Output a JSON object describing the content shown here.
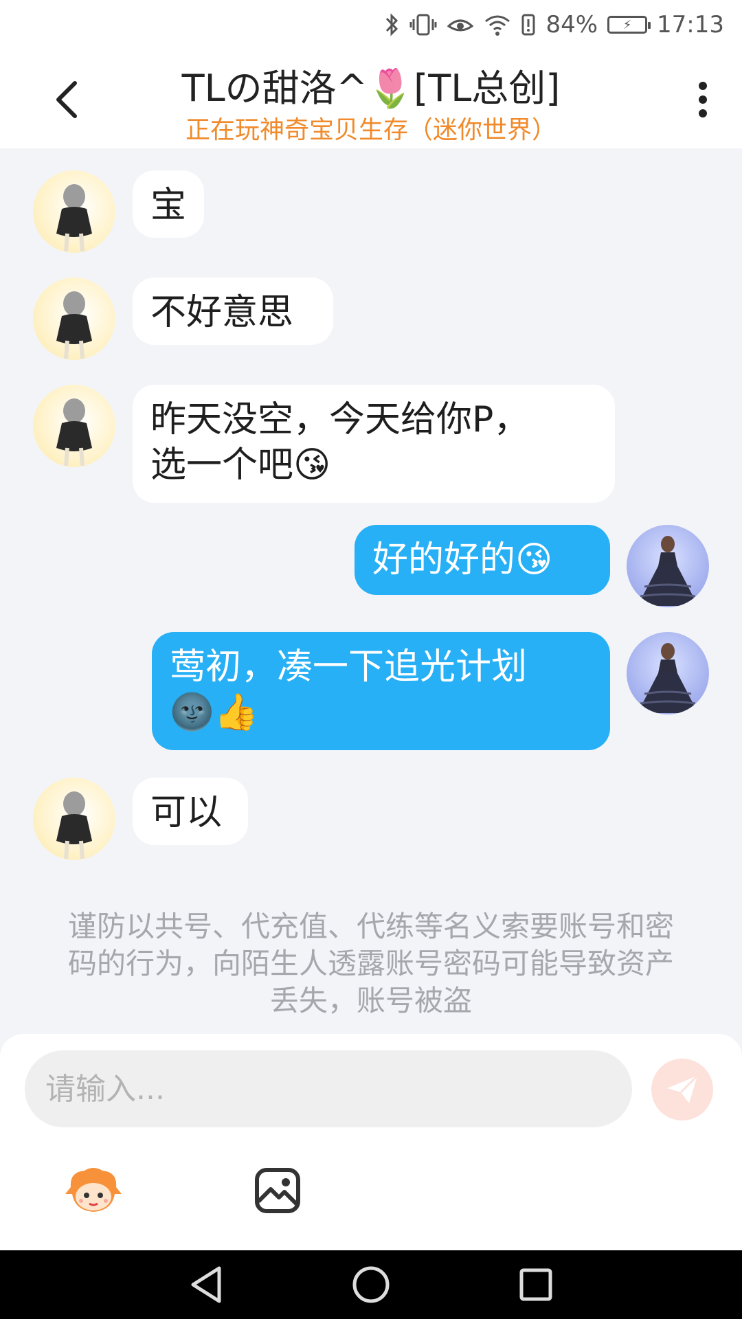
{
  "status_bar": {
    "icons": [
      "bluetooth-icon",
      "vibrate-icon",
      "eye-comfort-icon",
      "wifi-icon",
      "battery-alert-icon"
    ],
    "battery_percent": "84%",
    "time": "17:13"
  },
  "header": {
    "title": "TLの甜洛^🌷[TL总创]",
    "subtitle": "正在玩神奇宝贝生存（迷你世界）",
    "back_icon": "chevron-left-icon",
    "more_icon": "more-vertical-icon"
  },
  "messages": [
    {
      "sender": "other",
      "text": "宝"
    },
    {
      "sender": "other",
      "text": "不好意思"
    },
    {
      "sender": "other",
      "text": "昨天没空，今天给你P，\n选一个吧😘"
    },
    {
      "sender": "me",
      "text": "好的好的😘"
    },
    {
      "sender": "me",
      "text": "莺初，凑一下追光计划\n🌚👍"
    },
    {
      "sender": "other",
      "text": "可以"
    }
  ],
  "warning_text": "谨防以共号、代充值、代练等名义索要账号和密码的行为，向陌生人透露账号密码可能导致资产丢失，账号被盗",
  "composer": {
    "placeholder": "请输入...",
    "send_icon": "send-icon",
    "tools": [
      "emoji-mascot-icon",
      "image-icon"
    ]
  },
  "nav_bar": {
    "buttons": [
      "back-triangle-icon",
      "home-circle-icon",
      "recents-square-icon"
    ]
  },
  "colors": {
    "accent_blue": "#27b0f5",
    "subtitle_orange": "#f08a2a",
    "background": "#f3f4f8"
  }
}
